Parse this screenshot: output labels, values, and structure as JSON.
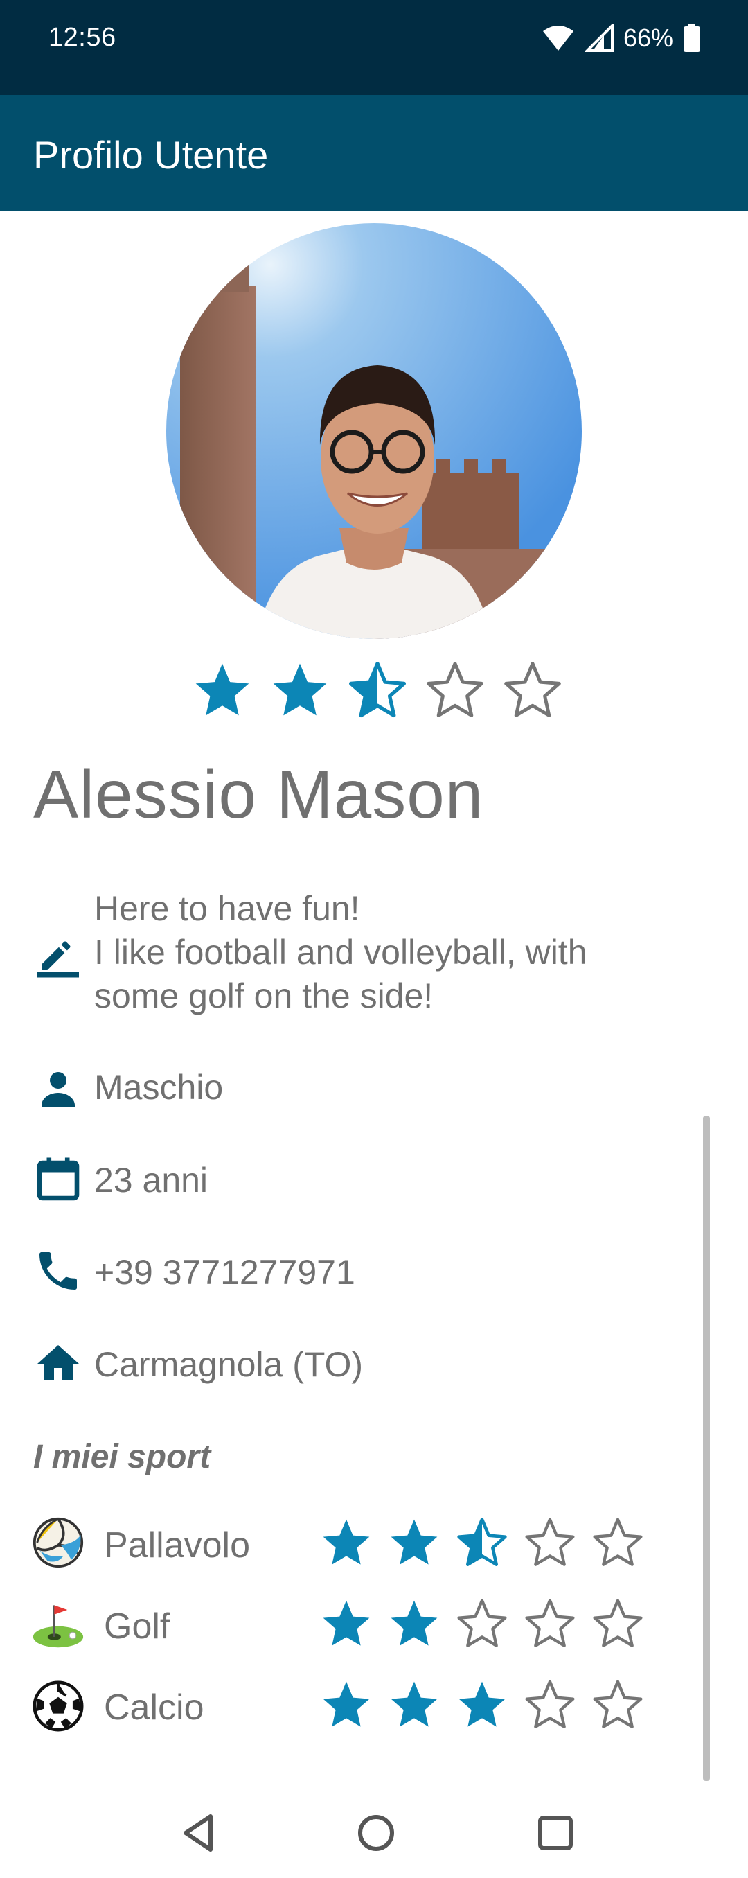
{
  "status_bar": {
    "time": "12:56",
    "battery": "66%",
    "icons": [
      "wifi-icon",
      "signal-icon",
      "battery-icon"
    ]
  },
  "app_bar": {
    "title": "Profilo Utente"
  },
  "profile": {
    "rating": 2.5,
    "rating_max": 5,
    "name": "Alessio Mason",
    "bio_lines": [
      "Here to have fun!",
      "I like football and volleyball, with",
      "some golf on the side!"
    ],
    "gender": "Maschio",
    "age": "23 anni",
    "phone": "+39 3771277971",
    "city": "Carmagnola (TO)"
  },
  "sports_section": {
    "title": "I miei sport",
    "items": [
      {
        "name": "Pallavolo",
        "icon": "volleyball-icon",
        "rating": 2.5
      },
      {
        "name": "Golf",
        "icon": "golf-icon",
        "rating": 2
      },
      {
        "name": "Calcio",
        "icon": "soccer-ball-icon",
        "rating": 3
      }
    ]
  },
  "colors": {
    "status_bar": "#012c42",
    "app_bar": "#024f6c",
    "star_filled": "#0c86b6",
    "star_empty": "#757575",
    "icon": "#034f6c",
    "text": "#707070"
  },
  "nav_bar": {
    "icons": [
      "back-icon",
      "home-icon",
      "recents-icon"
    ]
  }
}
